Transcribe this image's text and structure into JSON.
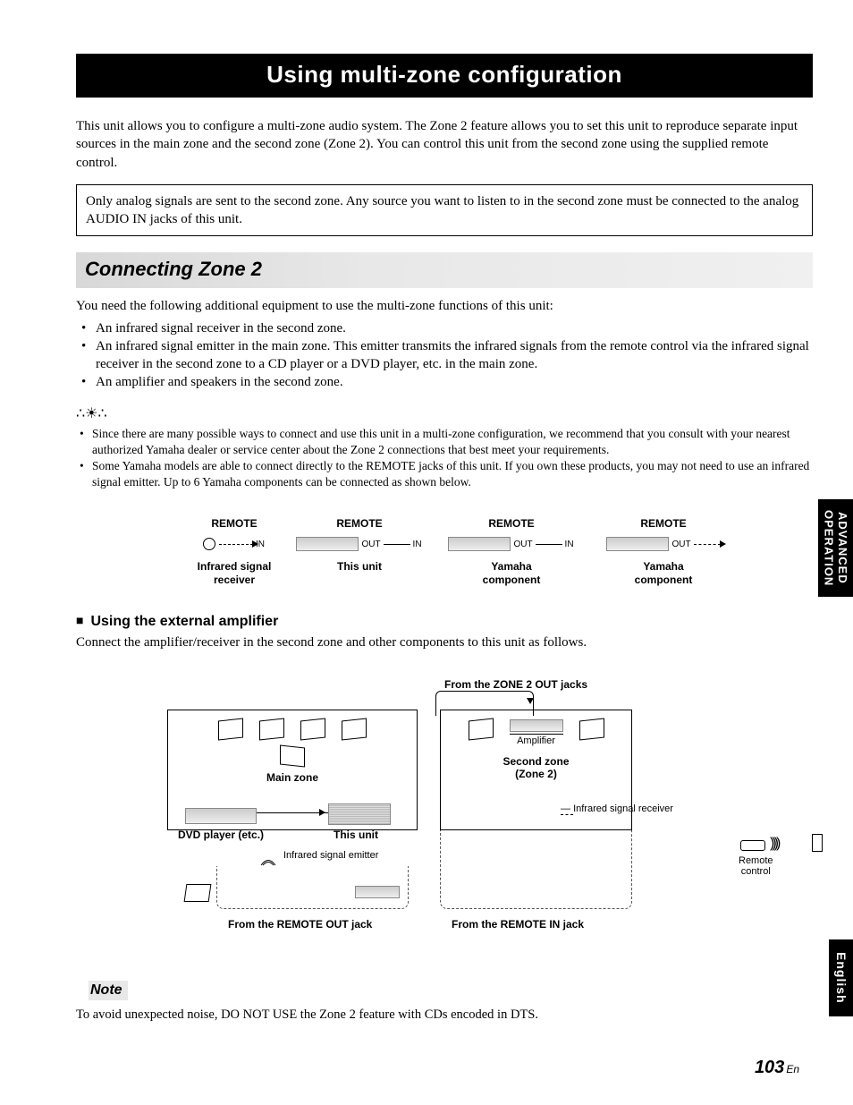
{
  "title": "Using multi-zone configuration",
  "intro": "This unit allows you to configure a multi-zone audio system. The Zone 2 feature allows you to set this unit to reproduce separate input sources in the main zone and the second zone (Zone 2). You can control this unit from the second zone using the supplied remote control.",
  "infobox": "Only analog signals are sent to the second zone. Any source you want to listen to in the second zone must be connected to the analog AUDIO IN jacks of this unit.",
  "section1_header": "Connecting Zone 2",
  "needs_intro": "You need the following additional equipment to use the multi-zone functions of this unit:",
  "needs": [
    "An infrared signal receiver in the second zone.",
    "An infrared signal emitter in the main zone. This emitter transmits the infrared signals from the remote control via the infrared signal receiver in the second zone to a CD player or a DVD player, etc. in the main zone.",
    "An amplifier and speakers in the second zone."
  ],
  "tips": [
    "Since there are many possible ways to connect and use this unit in a multi-zone configuration, we recommend that you consult with your nearest authorized Yamaha dealer or service center about the Zone 2 connections that best meet your requirements.",
    "Some Yamaha models are able to connect directly to the REMOTE jacks of this unit. If you own these products, you may not need to use an infrared signal emitter. Up to 6 Yamaha components can be connected as shown below."
  ],
  "chain": {
    "remote": "REMOTE",
    "in": "IN",
    "out": "OUT",
    "captions": [
      "Infrared signal\nreceiver",
      "This unit",
      "Yamaha\ncomponent",
      "Yamaha\ncomponent"
    ]
  },
  "subheading": "Using the external amplifier",
  "subtext": "Connect the amplifier/receiver in the second zone and other components to this unit as follows.",
  "diagram": {
    "from_zone2": "From the ZONE 2 OUT jacks",
    "amplifier": "Amplifier",
    "main_zone": "Main zone",
    "second_zone_l1": "Second zone",
    "second_zone_l2": "(Zone 2)",
    "dvd": "DVD player (etc.)",
    "this_unit": "This unit",
    "ir_emitter": "Infrared signal emitter",
    "remote_control": "Remote control",
    "ir_receiver": "Infrared signal receiver",
    "from_remote_out": "From the REMOTE OUT jack",
    "from_remote_in": "From the REMOTE IN jack"
  },
  "note_label": "Note",
  "note_text": "To avoid unexpected noise, DO NOT USE the Zone 2 feature with CDs encoded in DTS.",
  "tab_advanced": "ADVANCED\nOPERATION",
  "tab_english": "English",
  "page_number": "103",
  "page_suffix": "En"
}
